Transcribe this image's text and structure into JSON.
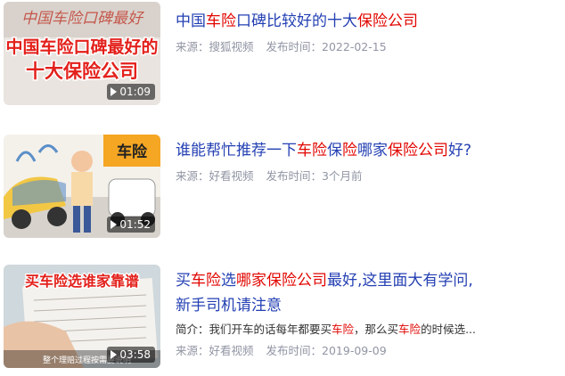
{
  "results": [
    {
      "title_parts": [
        {
          "t": "中国",
          "hl": false
        },
        {
          "t": "车险",
          "hl": true
        },
        {
          "t": "口碑比较好的十大",
          "hl": false
        },
        {
          "t": "保险公司",
          "hl": true
        }
      ],
      "source": "来源：搜狐视频",
      "date": "发布时间：2022-02-15",
      "duration": "01:09",
      "thumb_text_1": "中国车险口碑最好的",
      "thumb_text_2": "十大保险公司",
      "thumb_scribble": "中国车险口碑最好"
    },
    {
      "title_parts": [
        {
          "t": "谁能帮忙推荐一下",
          "hl": false
        },
        {
          "t": "车险",
          "hl": true
        },
        {
          "t": "保",
          "hl": false
        },
        {
          "t": "险",
          "hl": true
        },
        {
          "t": "哪家",
          "hl": false
        },
        {
          "t": "保险公司",
          "hl": true
        },
        {
          "t": "好",
          "hl": false
        },
        {
          "t": "?",
          "hl": false
        }
      ],
      "source": "来源：好看视频",
      "date": "发布时间：3个月前",
      "duration": "01:52",
      "thumb_sign": "车险"
    },
    {
      "title_line1_parts": [
        {
          "t": "买",
          "hl": false
        },
        {
          "t": "车险",
          "hl": true
        },
        {
          "t": "选",
          "hl": false
        },
        {
          "t": "哪家保险公司",
          "hl": true
        },
        {
          "t": "最好,这里面大有学问,",
          "hl": false
        }
      ],
      "title_line2": "新手司机请注意",
      "desc_parts": [
        {
          "t": "简介：我们开车的话每年都要买",
          "hl": false
        },
        {
          "t": "车险",
          "hl": true
        },
        {
          "t": "，那么买",
          "hl": false
        },
        {
          "t": "车险",
          "hl": true
        },
        {
          "t": "的时候选...",
          "hl": false
        }
      ],
      "source": "来源：好看视频",
      "date": "发布时间：2019-09-09",
      "duration": "03:58",
      "thumb_banner": "买车险选谁家靠谱",
      "thumb_caption": "整个理赔过程按需要说明"
    }
  ]
}
